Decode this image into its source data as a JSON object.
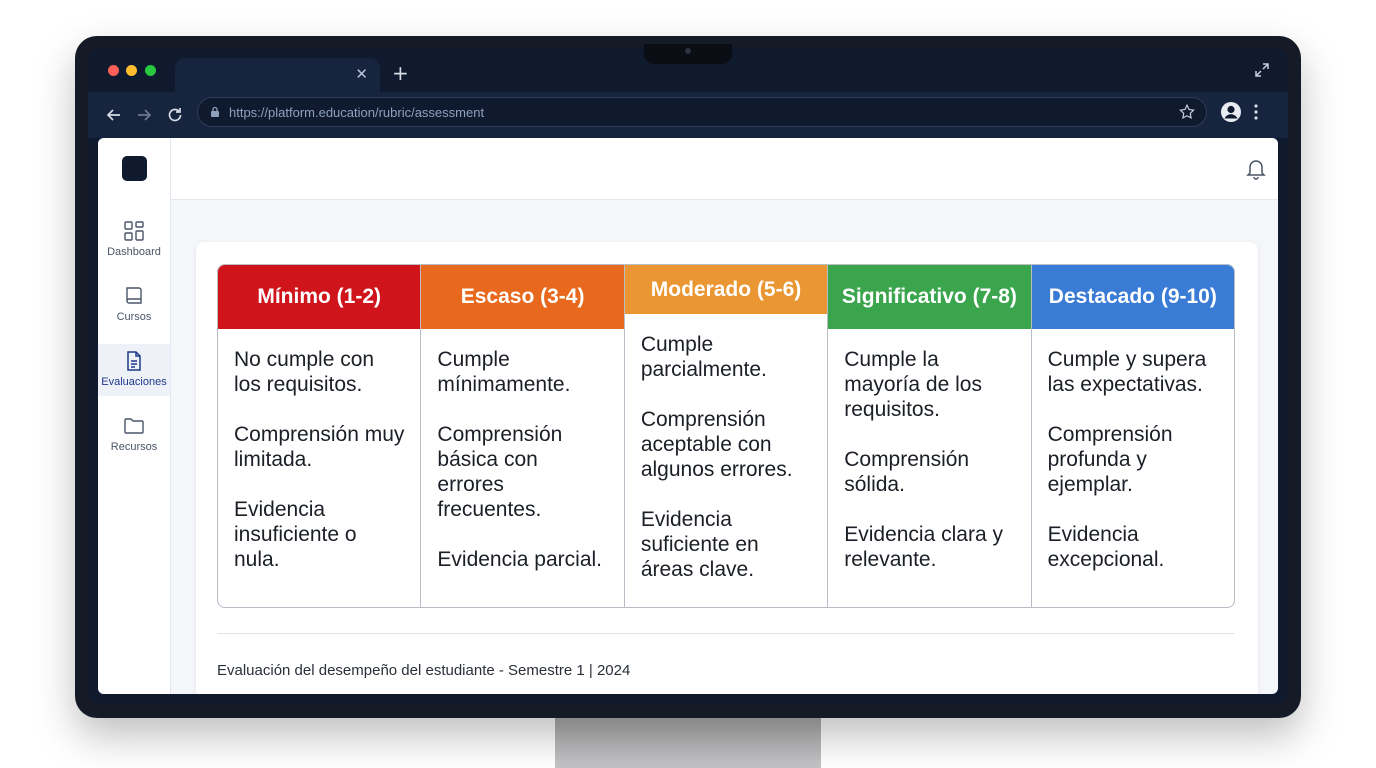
{
  "browser": {
    "tab_close_glyph": "✕",
    "new_tab_glyph": "+",
    "url": "https://platform.education/rubric/assessment"
  },
  "sidebar": {
    "items": [
      {
        "label": "Dashboard",
        "icon": "grid-icon"
      },
      {
        "label": "Cursos",
        "icon": "book-icon"
      },
      {
        "label": "Evaluaciones",
        "icon": "document-icon",
        "active": true
      },
      {
        "label": "Recursos",
        "icon": "folder-icon"
      }
    ]
  },
  "rubric": {
    "levels": [
      {
        "title": "Mínimo (1-2)",
        "color": "#d0141c",
        "criteria": [
          "No cumple con los requisitos.",
          "Comprensión muy limitada.",
          "Evidencia insuficiente o nula."
        ]
      },
      {
        "title": "Escaso (3-4)",
        "color": "#e8691e",
        "criteria": [
          "Cumple mínimamente.",
          "Comprensión básica con errores frecuentes.",
          "Evidencia parcial."
        ]
      },
      {
        "title": "Moderado (5-6)",
        "color": "#ea9632",
        "criteria": [
          "Cumple parcialmente.",
          "Comprensión aceptable con algunos errores.",
          "Evidencia suficiente en áreas clave."
        ]
      },
      {
        "title": "Significativo (7-8)",
        "color": "#3aa54d",
        "criteria": [
          "Cumple la mayoría de los requisitos.",
          "Comprensión sólida.",
          "Evidencia clara y relevante."
        ]
      },
      {
        "title": "Destacado (9-10)",
        "color": "#3a7bd5",
        "criteria": [
          "Cumple y supera las expectativas.",
          "Comprensión profunda y ejemplar.",
          "Evidencia excepcional."
        ]
      }
    ]
  },
  "footer": {
    "text": "Evaluación del desempeño del estudiante - Semestre 1 | 2024"
  }
}
